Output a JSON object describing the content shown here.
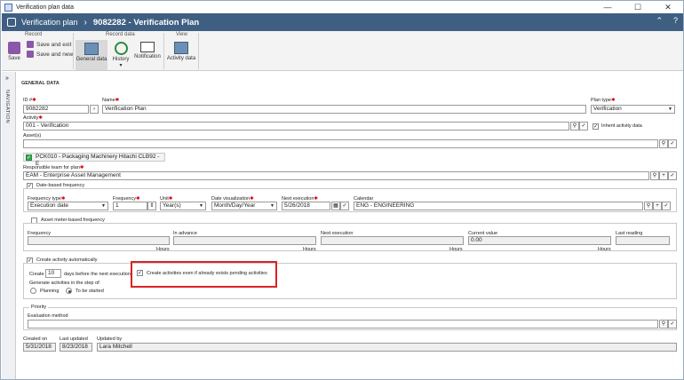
{
  "window": {
    "title": "Verification plan data"
  },
  "header": {
    "breadcrumb": "Verification plan",
    "record": "9082282 - Verification Plan"
  },
  "ribbon": {
    "record_group": "Record",
    "save": "Save",
    "save_exit": "Save and exit",
    "save_new": "Save and new",
    "record_data_group": "Record data",
    "general_data": "General data",
    "history": "History",
    "notification": "Notification",
    "view_group": "View",
    "activity_data": "Activity data"
  },
  "nav": {
    "label": "NAVIGATION"
  },
  "form": {
    "section": "GENERAL DATA",
    "id_label": "ID #",
    "id_value": "9082282",
    "name_label": "Name",
    "name_value": "Verification Plan",
    "plan_type_label": "Plan type",
    "plan_type_value": "Verification",
    "activity_label": "Activity",
    "activity_value": "001 - Verification",
    "inherit_label": "Inherit activity data",
    "assets_label": "Asset(s)",
    "asset_chip": "PCK010 - Packaging Machinery Hitachi CLB92 - E",
    "team_label": "Responsible team for plan",
    "team_value": "EAM - Enterprise Asset Management",
    "date_freq_label": "Date-based frequency",
    "freq_type_label": "Frequency type",
    "freq_type_value": "Execution date",
    "frequency_label": "Frequency",
    "frequency_value": "1",
    "unit_label": "Unit",
    "unit_value": "Year(s)",
    "date_vis_label": "Date visualization",
    "date_vis_value": "Month/Day/Year",
    "next_exec_label": "Next execution",
    "next_exec_value": "5/26/2018",
    "calendar_label": "Calendar",
    "calendar_value": "ENG - ENGINEERING",
    "meter_freq_label": "Asset meter-based frequency",
    "m_frequency_label": "Frequency",
    "m_in_advance_label": "In advance",
    "m_next_exec_label": "Next execution",
    "m_current_label": "Current value",
    "m_current_value": "0.00",
    "m_last_reading_label": "Last reading",
    "hours": "Hours",
    "create_auto_label": "Create activity automatically",
    "create_label": "Create",
    "create_days_value": "10",
    "create_days_suffix": "days before the next execution",
    "create_even_label": "Create activities even if already exists pending activities",
    "generate_label": "Generate activities in the step of:",
    "planning_label": "Planning",
    "to_be_started_label": "To be started",
    "priority_label": "Priority",
    "eval_method_label": "Evaluation method",
    "created_on_label": "Created on",
    "created_on_value": "5/31/2018",
    "last_updated_label": "Last updated",
    "last_updated_value": "8/23/2018",
    "updated_by_label": "Updated by",
    "updated_by_value": "Lara Mitchell"
  }
}
